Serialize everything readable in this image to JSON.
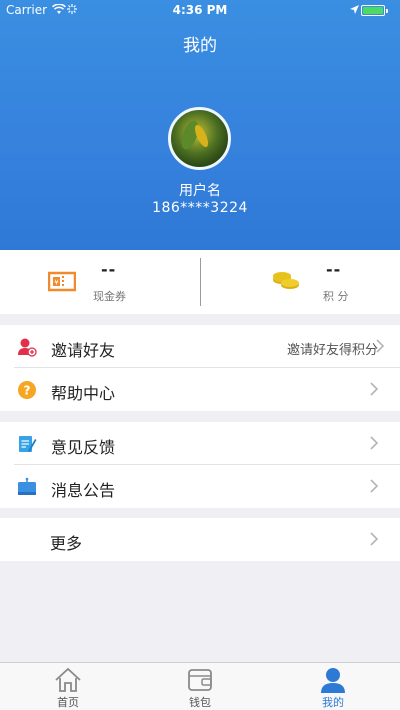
{
  "status_bar": {
    "carrier": "Carrier",
    "time": "4:36 PM"
  },
  "header": {
    "title": "我的",
    "username": "用户名",
    "phone": "186****3224"
  },
  "stats": [
    {
      "value": "--",
      "label": "现金券",
      "icon": "coupon-icon"
    },
    {
      "value": "--",
      "label": "积 分",
      "icon": "coins-icon"
    }
  ],
  "menu": {
    "invite": {
      "label": "邀请好友",
      "detail": "邀请好友得积分",
      "icon": "invite-user-icon"
    },
    "help": {
      "label": "帮助中心",
      "icon": "help-icon"
    },
    "feedback": {
      "label": "意见反馈",
      "icon": "feedback-icon"
    },
    "notice": {
      "label": "消息公告",
      "icon": "announcement-icon"
    },
    "more": {
      "label": "更多"
    }
  },
  "tabbar": [
    {
      "label": "首页",
      "icon": "home-icon",
      "active": false
    },
    {
      "label": "钱包",
      "icon": "wallet-icon",
      "active": false
    },
    {
      "label": "我的",
      "icon": "profile-icon",
      "active": true
    }
  ],
  "colors": {
    "accent": "#2f79d6",
    "header_gradient_top": "#3a8fe2",
    "coupon": "#f08a2c",
    "coins": "#e8c21c",
    "invite": "#e0304a",
    "help": "#f5a623",
    "feedback": "#36a3e8"
  }
}
